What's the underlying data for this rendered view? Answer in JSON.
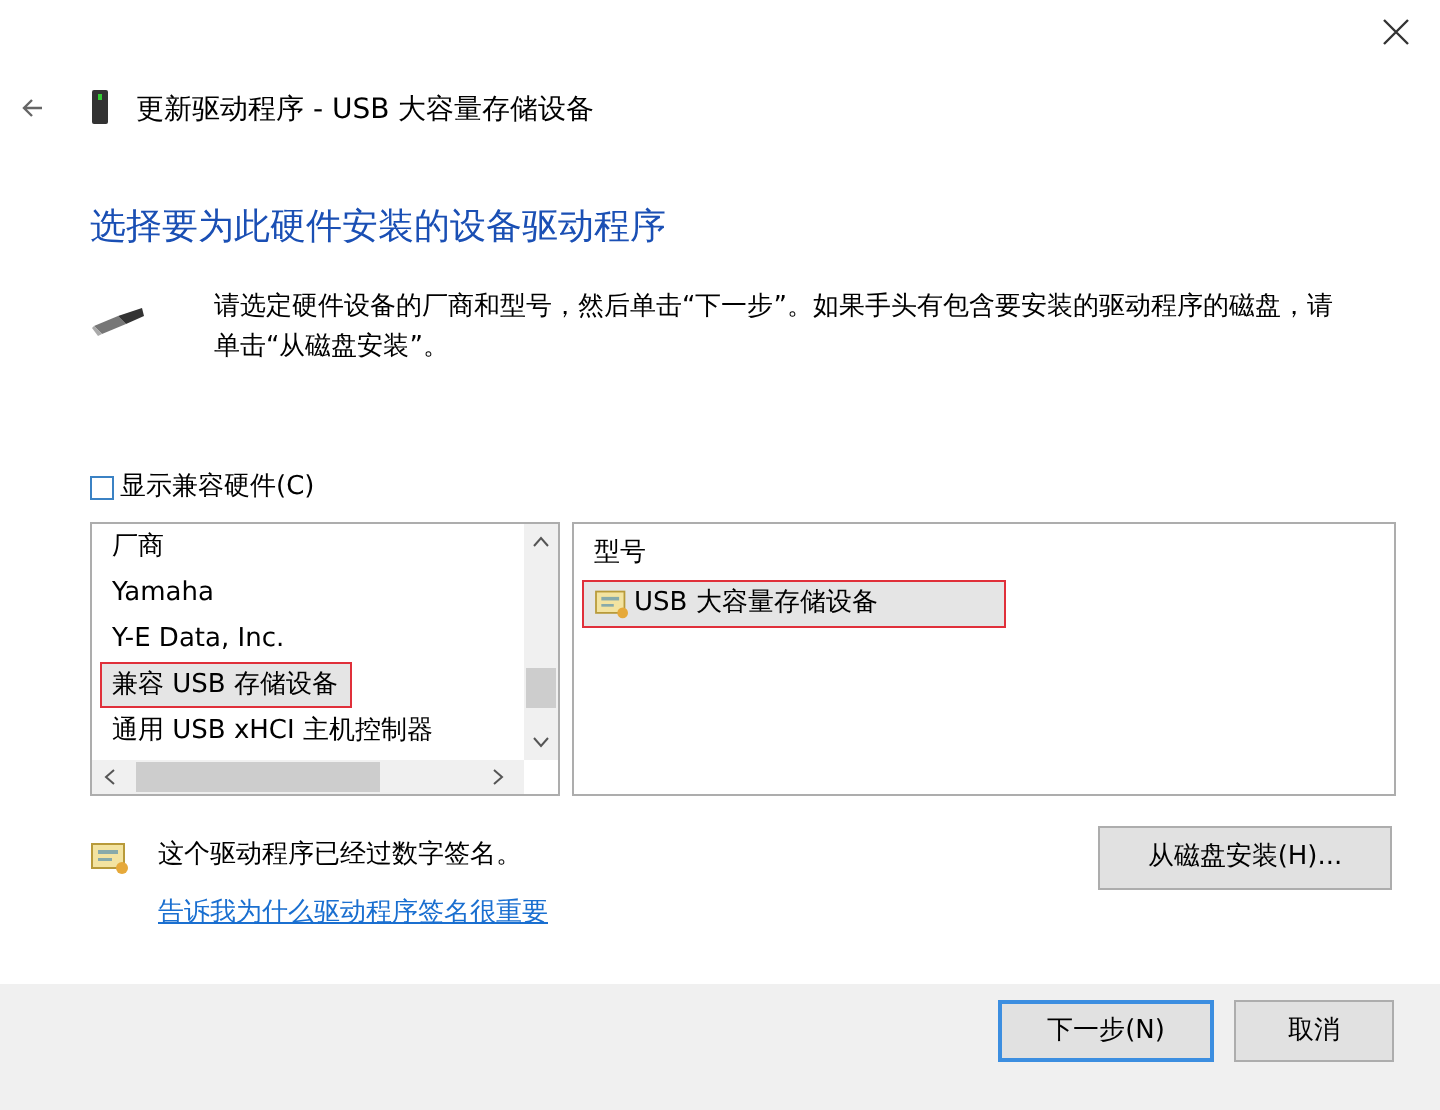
{
  "window": {
    "title": "更新驱动程序 - USB 大容量存储设备"
  },
  "heading": "选择要为此硬件安装的设备驱动程序",
  "description": "请选定硬件设备的厂商和型号，然后单击“下一步”。如果手头有包含要安装的驱动程序的磁盘，请单击“从磁盘安装”。",
  "show_compatible": {
    "label": "显示兼容硬件(C)",
    "checked": false
  },
  "manufacturers": {
    "header": "厂商",
    "items": [
      {
        "label": "Yamaha",
        "selected": false,
        "highlighted": false
      },
      {
        "label": "Y-E Data, Inc.",
        "selected": false,
        "highlighted": false
      },
      {
        "label": "兼容 USB 存储设备",
        "selected": true,
        "highlighted": true
      },
      {
        "label": "通用 USB xHCI 主机控制器",
        "selected": false,
        "highlighted": false
      }
    ]
  },
  "models": {
    "header": "型号",
    "items": [
      {
        "label": "USB 大容量存储设备",
        "selected": true,
        "highlighted": true
      }
    ]
  },
  "signature": {
    "text": "这个驱动程序已经过数字签名。",
    "link": "告诉我为什么驱动程序签名很重要"
  },
  "have_disk_button": "从磁盘安装(H)...",
  "buttons": [
    {
      "label": "下一步(N)",
      "default": true
    },
    {
      "label": "取消",
      "default": false
    }
  ]
}
